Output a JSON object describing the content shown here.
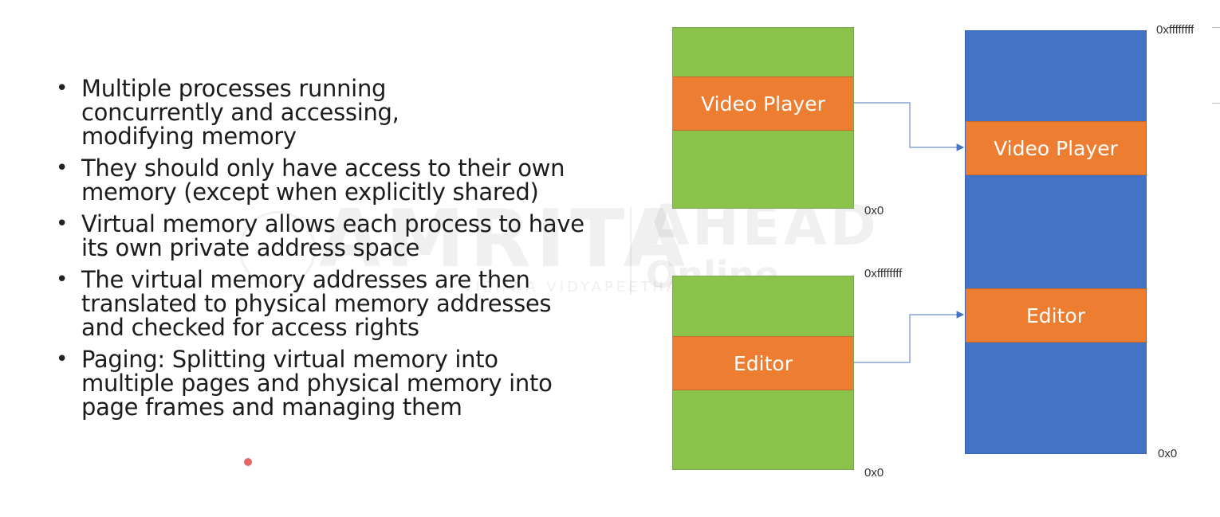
{
  "bullets": [
    "Multiple processes running concurrently and accessing, modifying memory",
    "They should only have access to their own memory (except when explicitly shared)",
    "Virtual memory allows each process to have its own private address space",
    "The virtual memory addresses are then translated to physical memory addresses and checked for access rights",
    "Paging: Splitting virtual memory into multiple pages and  physical memory into page frames and managing them"
  ],
  "bullet_symbol": "•",
  "watermark": {
    "word": "AMRITA",
    "sub": "VISHWA VIDYAPEETHAM",
    "brand": "AHEAD",
    "brand_sub": "Online"
  },
  "diagram": {
    "process_video": {
      "segment": "Video Player",
      "bottom_addr": "0x0"
    },
    "process_editor": {
      "segment": "Editor",
      "top_addr": "0xffffffff",
      "bottom_addr": "0x0"
    },
    "physical": {
      "top_addr": "0xffffffff",
      "bottom_addr": "0x0",
      "segments": [
        "Video Player",
        "Editor"
      ]
    },
    "colors": {
      "virtual": "#8bc34a",
      "physical": "#4472c4",
      "segment": "#ed7d31",
      "arrow": "#4472c4"
    }
  }
}
